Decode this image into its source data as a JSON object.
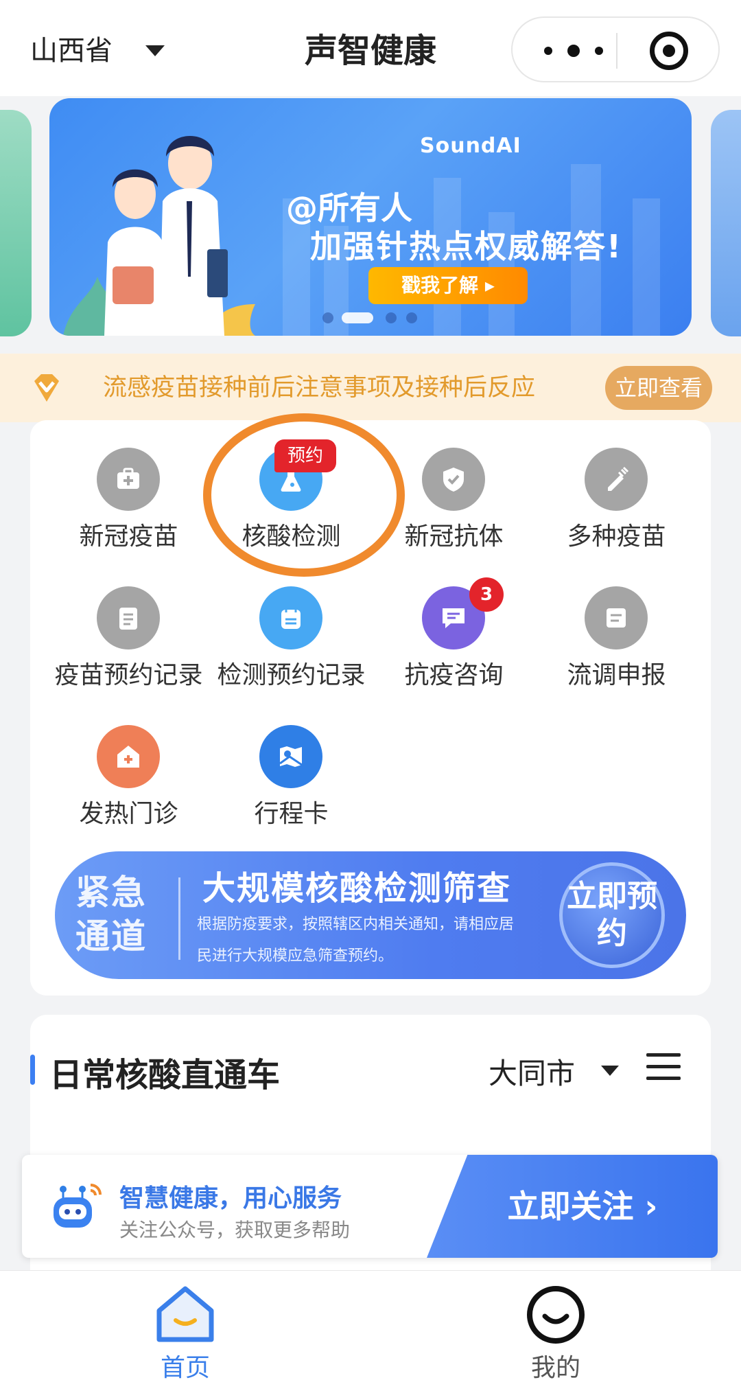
{
  "header": {
    "province": "山西省",
    "title": "声智健康"
  },
  "banner": {
    "brand": "SoundAI",
    "line1": "@所有人",
    "line2": "加强针热点权威解答!",
    "button": "戳我了解 ▸",
    "page_count": 4,
    "active_page": 2
  },
  "notice": {
    "text": "流感疫苗接种前后注意事项及接种后反应",
    "button": "立即查看"
  },
  "services": [
    {
      "label": "新冠疫苗",
      "icon": "medical-kit-icon",
      "color": "#a5a5a5"
    },
    {
      "label": "核酸检测",
      "icon": "flask-icon",
      "color": "#47a8f3",
      "badge": "预约"
    },
    {
      "label": "新冠抗体",
      "icon": "shield-check-icon",
      "color": "#a5a5a5"
    },
    {
      "label": "多种疫苗",
      "icon": "syringe-icon",
      "color": "#a5a5a5"
    },
    {
      "label": "疫苗预约记录",
      "icon": "clipboard-icon",
      "color": "#a5a5a5"
    },
    {
      "label": "检测预约记录",
      "icon": "calendar-icon",
      "color": "#47a8f3"
    },
    {
      "label": "抗疫咨询",
      "icon": "chat-icon",
      "color": "#7b63e0",
      "count": "3"
    },
    {
      "label": "流调申报",
      "icon": "form-icon",
      "color": "#a5a5a5"
    },
    {
      "label": "发热门诊",
      "icon": "hospital-icon",
      "color": "#ef7f57"
    },
    {
      "label": "行程卡",
      "icon": "map-card-icon",
      "color": "#2f7fe6"
    }
  ],
  "emergency": {
    "side_text": "紧急通道",
    "title": "大规模核酸检测筛查",
    "description": "根据防疫要求，按照辖区内相关通知，请相应居民进行大规模应急筛查预约。",
    "button": "立即预约"
  },
  "daily": {
    "title": "日常核酸直通车",
    "city": "大同市"
  },
  "follow": {
    "title": "智慧健康，用心服务",
    "subtitle": "关注公众号，获取更多帮助",
    "button": "立即关注 ›"
  },
  "tabs": [
    {
      "label": "首页",
      "active": true
    },
    {
      "label": "我的",
      "active": false
    }
  ],
  "colors": {
    "primary": "#3a7fea",
    "badge": "#e3242b",
    "notice_text": "#e29a2c",
    "highlight": "#f08a2d"
  }
}
